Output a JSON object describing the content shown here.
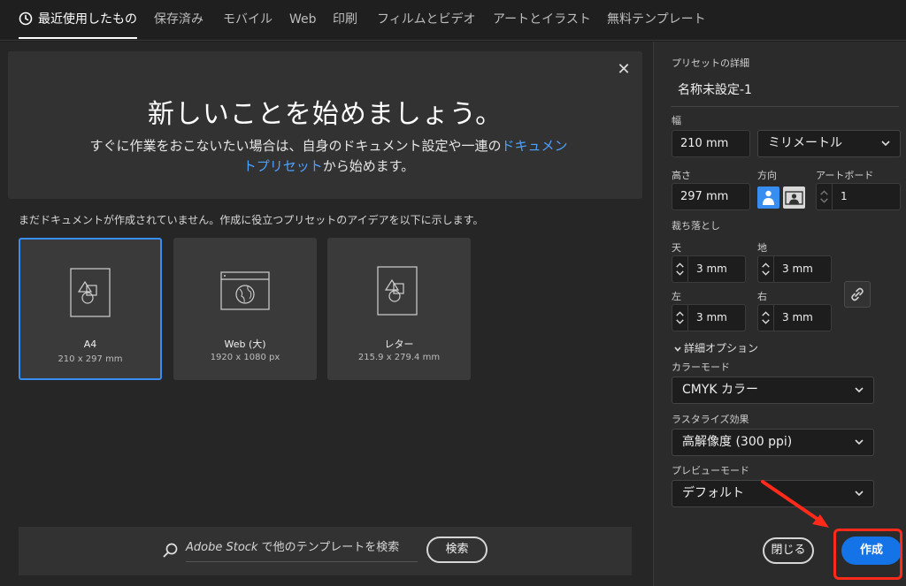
{
  "tabs": [
    {
      "label": "最近使用したもの",
      "active": true,
      "icon": "clock-icon"
    },
    {
      "label": "保存済み"
    },
    {
      "label": "モバイル"
    },
    {
      "label": "Web"
    },
    {
      "label": "印刷"
    },
    {
      "label": "フィルムとビデオ"
    },
    {
      "label": "アートとイラスト"
    },
    {
      "label": "無料テンプレート"
    }
  ],
  "hero": {
    "title": "新しいことを始めましょう。",
    "subtitle_part1": "すぐに作業をおこないたい場合は、自身のドキュメント設定や一連の",
    "subtitle_link": "ドキュメントプリセット",
    "subtitle_part2": "から始めます。",
    "close": "✕"
  },
  "empty_note": "まだドキュメントが作成されていません。作成に役立つプリセットのアイデアを以下に示します。",
  "presets": [
    {
      "name": "A4",
      "size": "210 x 297 mm",
      "selected": true,
      "icon": "document-shapes-icon"
    },
    {
      "name": "Web (大)",
      "size": "1920 x 1080 px",
      "icon": "browser-globe-icon"
    },
    {
      "name": "レター",
      "size": "215.9 x 279.4 mm",
      "icon": "document-shapes-icon"
    }
  ],
  "search": {
    "brand": "Adobe Stock",
    "placeholder_rest": " で他のテンプレートを検索",
    "button": "検索"
  },
  "panel": {
    "details_label": "プリセットの詳細",
    "preset_name": "名称未設定-1",
    "width_label": "幅",
    "width_value": "210 mm",
    "unit": "ミリメートル",
    "height_label": "高さ",
    "height_value": "297 mm",
    "orientation_label": "方向",
    "artboard_label": "アートボード",
    "artboard_value": "1",
    "bleed_label": "裁ち落とし",
    "bleed_top_label": "天",
    "bleed_top": "3 mm",
    "bleed_bottom_label": "地",
    "bleed_bottom": "3 mm",
    "bleed_left_label": "左",
    "bleed_left": "3 mm",
    "bleed_right_label": "右",
    "bleed_right": "3 mm",
    "advanced_label": "詳細オプション",
    "color_mode_label": "カラーモード",
    "color_mode": "CMYK カラー",
    "raster_label": "ラスタライズ効果",
    "raster": "高解像度 (300 ppi)",
    "preview_label": "プレビューモード",
    "preview": "デフォルト",
    "close_button": "閉じる",
    "create_button": "作成"
  },
  "colors": {
    "accent": "#378ef0",
    "primary_button": "#1473e6",
    "link": "#4ea1ff",
    "annotation": "#ff2a1a"
  }
}
